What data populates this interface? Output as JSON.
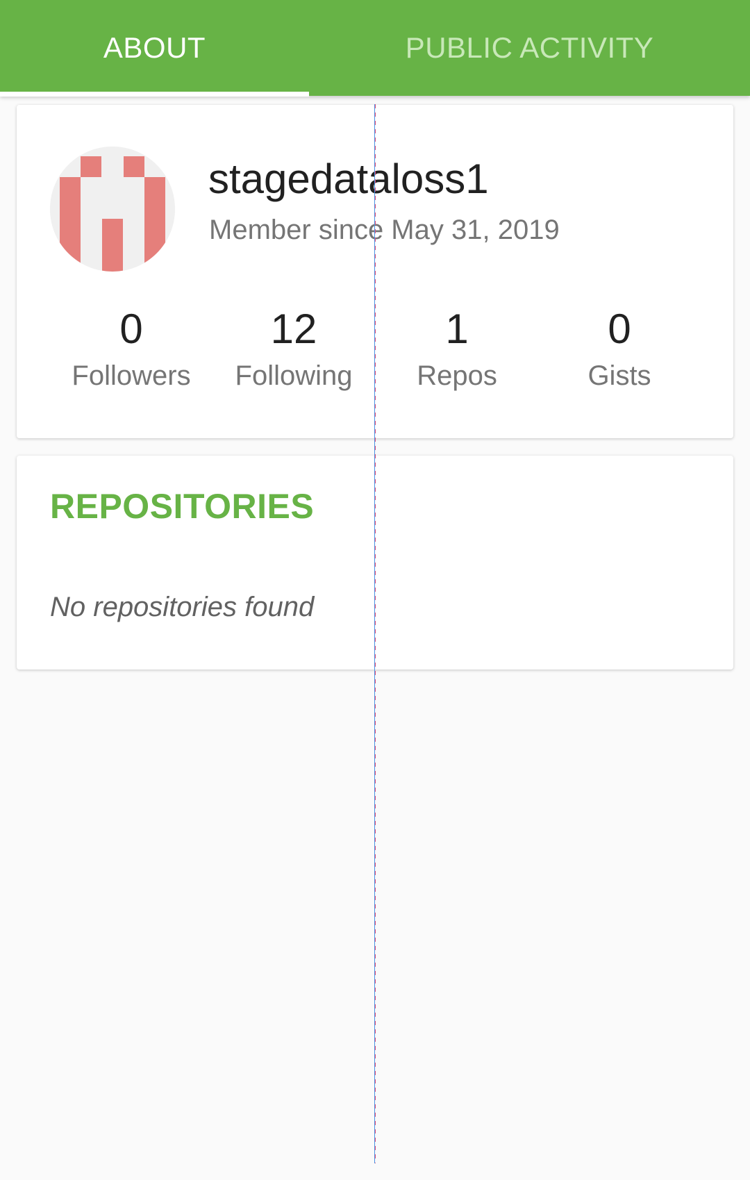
{
  "tabs": {
    "about_label": "ABOUT",
    "activity_label": "PUBLIC ACTIVITY"
  },
  "profile": {
    "username": "stagedataloss1",
    "member_since": "Member since May 31, 2019",
    "avatar_color": "#e57f7b"
  },
  "stats": {
    "followers": {
      "value": "0",
      "label": "Followers"
    },
    "following": {
      "value": "12",
      "label": "Following"
    },
    "repos": {
      "value": "1",
      "label": "Repos"
    },
    "gists": {
      "value": "0",
      "label": "Gists"
    }
  },
  "repositories": {
    "title": "REPOSITORIES",
    "empty_message": "No repositories found"
  },
  "colors": {
    "accent": "#67b346",
    "background": "#fafafa"
  }
}
